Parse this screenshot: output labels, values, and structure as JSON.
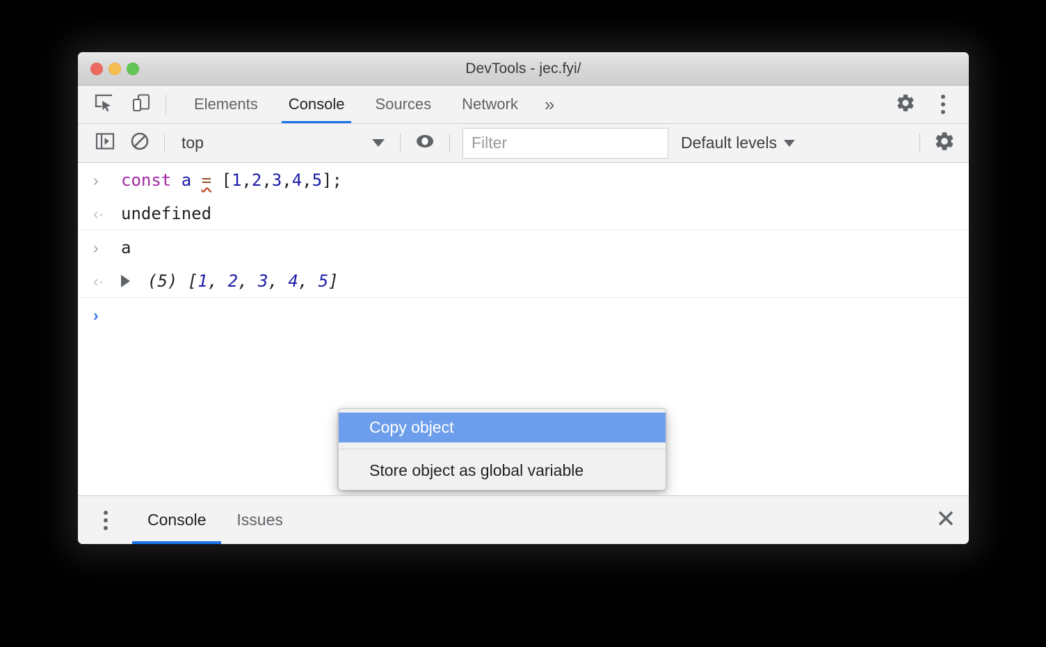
{
  "window": {
    "title": "DevTools - jec.fyi/",
    "traffic_lights": [
      {
        "name": "close",
        "color": "#ec6a5f"
      },
      {
        "name": "minimize",
        "color": "#f5bd4f"
      },
      {
        "name": "zoom",
        "color": "#61c454"
      }
    ]
  },
  "tabbar": {
    "icons": [
      "inspect-element-icon",
      "device-toolbar-icon"
    ],
    "tabs": [
      {
        "label": "Elements",
        "active": false
      },
      {
        "label": "Console",
        "active": true
      },
      {
        "label": "Sources",
        "active": false
      },
      {
        "label": "Network",
        "active": false
      }
    ],
    "more_label": "»",
    "right_icons": [
      "settings-gear-icon",
      "more-vertical-icon"
    ]
  },
  "console_toolbar": {
    "sidebar_toggle_icon": "console-sidebar-icon",
    "clear_console_icon": "clear-console-icon",
    "context": {
      "value": "top",
      "caret": "▼"
    },
    "eye_icon": "live-expression-eye-icon",
    "filter": {
      "value": "",
      "placeholder": "Filter"
    },
    "levels": {
      "label": "Default levels",
      "caret": "▼"
    },
    "settings_icon": "settings-gear-icon"
  },
  "console": {
    "rows": [
      {
        "id": "input-1",
        "type": "input",
        "gutter": "›",
        "tokens": [
          {
            "text": "const",
            "kind": "keyword"
          },
          {
            "text": " ",
            "kind": "plain"
          },
          {
            "text": "a",
            "kind": "variable"
          },
          {
            "text": " ",
            "kind": "plain"
          },
          {
            "text": "=",
            "kind": "operator"
          },
          {
            "text": " ",
            "kind": "plain"
          },
          {
            "text": "[",
            "kind": "plain"
          },
          {
            "text": "1",
            "kind": "number"
          },
          {
            "text": ",",
            "kind": "plain"
          },
          {
            "text": "2",
            "kind": "number"
          },
          {
            "text": ",",
            "kind": "plain"
          },
          {
            "text": "3",
            "kind": "number"
          },
          {
            "text": ",",
            "kind": "plain"
          },
          {
            "text": "4",
            "kind": "number"
          },
          {
            "text": ",",
            "kind": "plain"
          },
          {
            "text": "5",
            "kind": "number"
          },
          {
            "text": "];",
            "kind": "plain"
          }
        ],
        "plain_text": "const a = [1,2,3,4,5];"
      },
      {
        "id": "output-1",
        "type": "output",
        "gutter": "‹·",
        "plain_text": "undefined"
      },
      {
        "id": "input-2",
        "type": "input",
        "gutter": "›",
        "plain_text": "a"
      },
      {
        "id": "output-2",
        "type": "output-object",
        "gutter": "‹·",
        "disclosure": "collapsed",
        "length_label": "(5)",
        "open_bracket": "[",
        "items": [
          "1",
          "2",
          "3",
          "4",
          "5"
        ],
        "close_bracket": "]",
        "plain_text": "(5) [1, 2, 3, 4, 5]"
      },
      {
        "id": "prompt",
        "type": "prompt",
        "gutter": "›",
        "plain_text": ""
      }
    ]
  },
  "context_menu": {
    "items": [
      {
        "label": "Copy object",
        "selected": true
      },
      {
        "label": "Store object as global variable",
        "selected": false
      }
    ]
  },
  "drawer": {
    "menu_icon": "more-vertical-icon",
    "tabs": [
      {
        "label": "Console",
        "active": true
      },
      {
        "label": "Issues",
        "active": false
      }
    ],
    "close_icon": "close-icon"
  },
  "colors": {
    "accent_blue": "#1a73e8",
    "menu_highlight": "#6d9eeb",
    "toolbar_bg": "#f3f3f3",
    "keyword_purple": "#a428a4",
    "number_blue": "#1a1aa6",
    "prompt_blue": "#3b78e7"
  }
}
